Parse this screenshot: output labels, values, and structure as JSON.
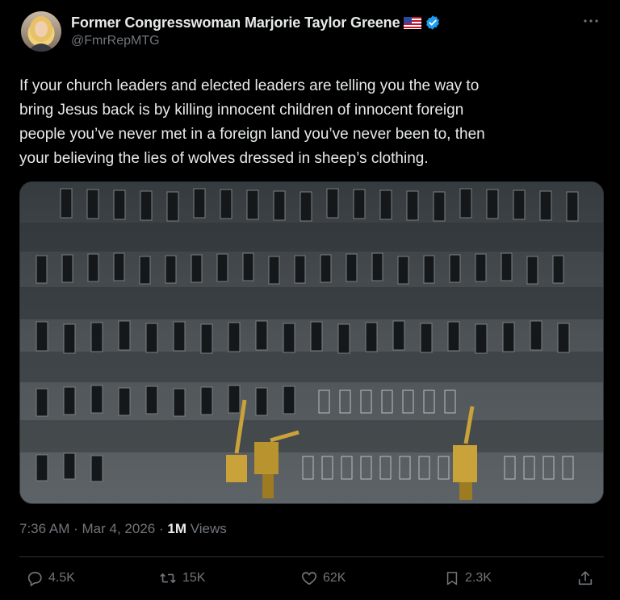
{
  "author": {
    "display_name": "Former Congresswoman Marjorie Taylor Greene",
    "handle": "@FmrRepMTG",
    "verified": true,
    "flag": "us-flag-emoji",
    "accent": "#1d9bf0"
  },
  "post": {
    "text": "If your church leaders and elected leaders are telling you the way to\nbring Jesus back is by killing innocent children of innocent foreign\npeople you’ve never met in a foreign land you’ve never been to, then\nyour believing the lies of wolves dressed in sheep’s clothing.",
    "media_description_icon": "aerial-photo"
  },
  "meta": {
    "time": "7:36 AM",
    "separator": "·",
    "date": "Mar 4, 2026",
    "views_count": "1M",
    "views_label": "Views"
  },
  "actions": {
    "reply_count": "4.5K",
    "repost_count": "15K",
    "like_count": "62K",
    "bookmark_count": "2.3K"
  },
  "icons": {
    "more": "more-horizontal-icon",
    "reply": "reply-icon",
    "repost": "repost-icon",
    "like": "heart-icon",
    "bookmark": "bookmark-icon",
    "share": "share-icon"
  }
}
